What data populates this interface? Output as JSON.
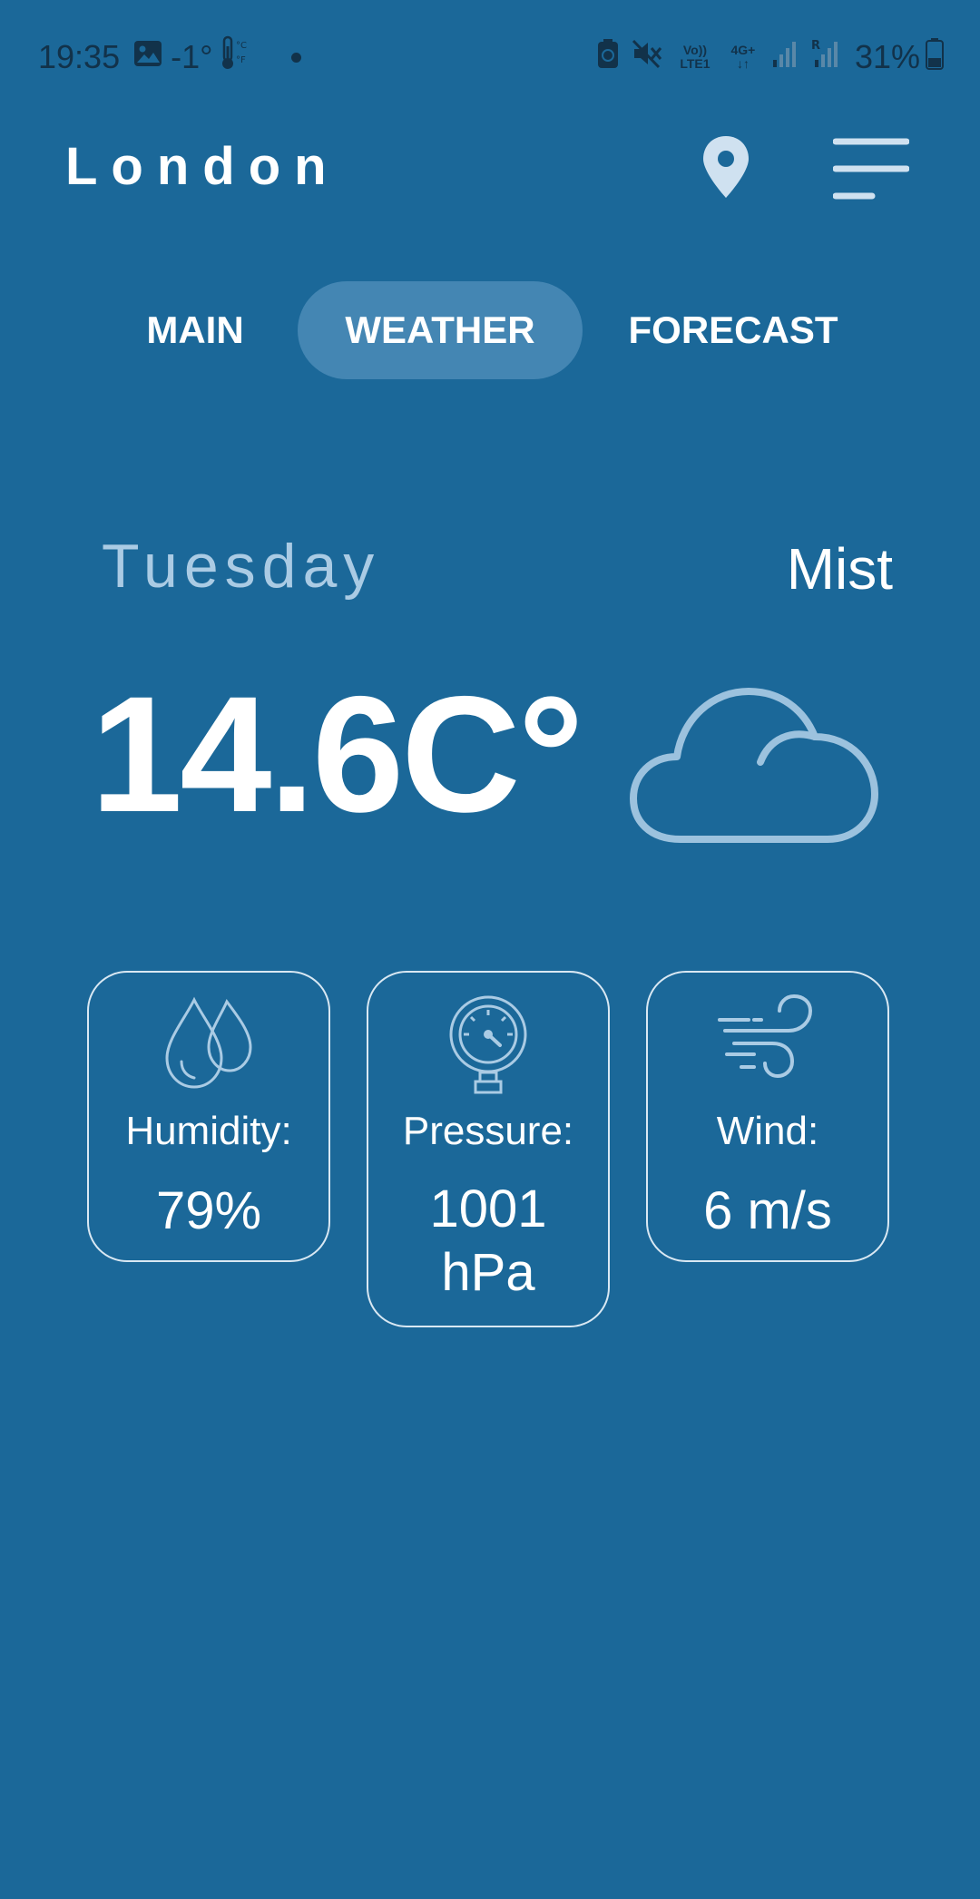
{
  "status_bar": {
    "time": "19:35",
    "temperature": "-1°",
    "battery_percent": "31%",
    "network_volte": "Vo)) LTE1",
    "network_4g": "4G+",
    "roaming": "R"
  },
  "header": {
    "city": "London",
    "location_icon": "location-pin-icon",
    "menu_icon": "menu-icon"
  },
  "tabs": [
    {
      "label": "MAIN",
      "active": false
    },
    {
      "label": "WEATHER",
      "active": true
    },
    {
      "label": "FORECAST",
      "active": false
    }
  ],
  "weather": {
    "day": "Tuesday",
    "description": "Mist",
    "temperature": "14.6C°",
    "icon": "cloud-icon"
  },
  "details": [
    {
      "label": "Humidity:",
      "value": "79%",
      "icon": "droplets-icon"
    },
    {
      "label": "Pressure:",
      "value_line1": "1001",
      "value_line2": "hPa",
      "icon": "pressure-gauge-icon"
    },
    {
      "label": "Wind:",
      "value": "6 m/s",
      "icon": "wind-icon"
    }
  ],
  "colors": {
    "background": "#1b6899",
    "active_tab": "#4486b3",
    "icon_light": "#aacbe4",
    "status_text": "#12324a"
  }
}
